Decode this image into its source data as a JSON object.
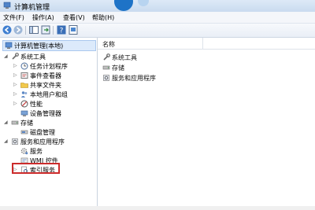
{
  "window": {
    "title": "计算机管理"
  },
  "menu": {
    "file": "文件(F)",
    "action": "操作(A)",
    "view": "查看(V)",
    "help": "帮助(H)"
  },
  "tree": {
    "root": "计算机管理(本地)",
    "system_tools": "系统工具",
    "task_scheduler": "任务计划程序",
    "event_viewer": "事件查看器",
    "shared_folders": "共享文件夹",
    "local_users": "本地用户和组",
    "performance": "性能",
    "device_manager": "设备管理器",
    "storage": "存储",
    "disk_management": "磁盘管理",
    "services_apps": "服务和应用程序",
    "services": "服务",
    "wmi": "WMI 控件",
    "index_service": "索引服务"
  },
  "list": {
    "column_name": "名称",
    "items": [
      "系统工具",
      "存储",
      "服务和应用程序"
    ]
  },
  "colors": {
    "selection": "#dceafb",
    "highlight": "#cc2b2b",
    "accent": "#1e73c7"
  }
}
